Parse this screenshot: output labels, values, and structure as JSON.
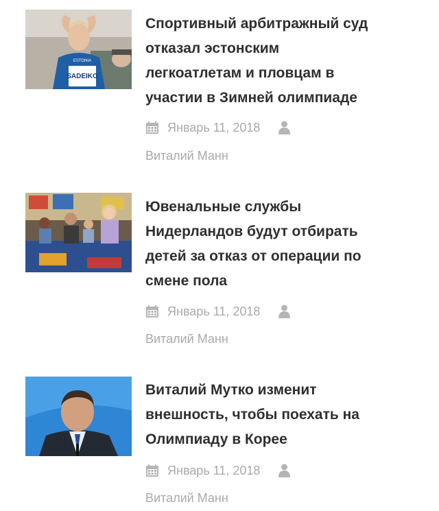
{
  "articles": [
    {
      "title": "Спортивный арбитражный суд\nотказал эстонским\nлегкоатлетам и пловцам в\nучастии в Зимней олимпиаде",
      "date": "Январь 11, 2018",
      "author": "Виталий Манн",
      "image_text": "SADEIKO",
      "image_text_top": "ESTONIA"
    },
    {
      "title": "Ювенальные службы\nНидерландов будут отбирать\nдетей за отказ от операции по\nсмене пола",
      "date": "Январь 11, 2018",
      "author": "Виталий Манн"
    },
    {
      "title": "Виталий Мутко изменит\nвнешность, чтобы поехать на\nОлимпиаду в Корее",
      "date": "Январь 11, 2018",
      "author": "Виталий Манн"
    }
  ],
  "icons": {
    "date": "calendar-icon",
    "author": "user-icon"
  },
  "colors": {
    "title": "#2f2f2f",
    "meta": "#a9a9a9"
  }
}
